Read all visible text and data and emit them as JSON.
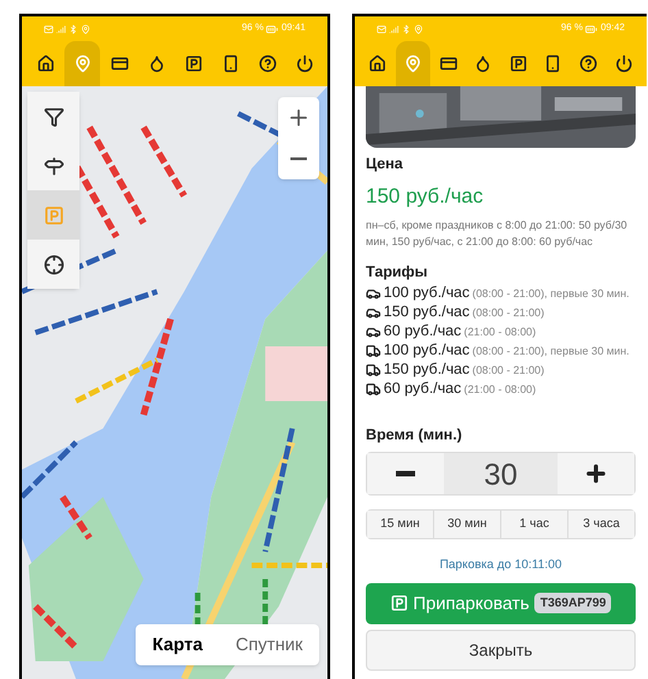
{
  "left_phone": {
    "status_bar": {
      "battery": "96 %",
      "time": "09:41"
    },
    "nav": [
      {
        "kind": "home",
        "selected": false
      },
      {
        "kind": "pin",
        "selected": true
      },
      {
        "kind": "card",
        "selected": false
      },
      {
        "kind": "drop",
        "selected": false
      },
      {
        "kind": "parking",
        "selected": false
      },
      {
        "kind": "phone",
        "selected": false
      },
      {
        "kind": "help",
        "selected": false
      },
      {
        "kind": "power",
        "selected": false
      }
    ],
    "map_tools": [
      {
        "kind": "filter",
        "selected": false
      },
      {
        "kind": "signpost",
        "selected": false
      },
      {
        "kind": "parking",
        "selected": true
      },
      {
        "kind": "locate",
        "selected": false
      }
    ],
    "map_type": [
      {
        "label": "Карта",
        "selected": true
      },
      {
        "label": "Спутник",
        "selected": false
      }
    ]
  },
  "right_phone": {
    "status_bar": {
      "battery": "96 %",
      "time": "09:42"
    },
    "nav": [
      {
        "kind": "home",
        "selected": false
      },
      {
        "kind": "pin",
        "selected": true
      },
      {
        "kind": "card",
        "selected": false
      },
      {
        "kind": "drop",
        "selected": false
      },
      {
        "kind": "parking",
        "selected": false
      },
      {
        "kind": "phone",
        "selected": false
      },
      {
        "kind": "help",
        "selected": false
      },
      {
        "kind": "power",
        "selected": false
      }
    ],
    "price_label": "Цена",
    "price": "150 руб./час",
    "description": "пн–сб, кроме праздников с 8:00 до 21:00: 50 руб/30 мин, 150 руб/час, с 21:00 до 8:00: 60 руб/час",
    "tariffs_title": "Тарифы",
    "tariffs": [
      {
        "kind": "car",
        "price": "100 руб./час",
        "note": "(08:00 - 21:00), первые 30 мин."
      },
      {
        "kind": "car",
        "price": "150 руб./час",
        "note": "(08:00 - 21:00)"
      },
      {
        "kind": "car",
        "price": "60 руб./час",
        "note": "(21:00 - 08:00)"
      },
      {
        "kind": "truck",
        "price": "100 руб./час",
        "note": "(08:00 - 21:00), первые 30 мин."
      },
      {
        "kind": "truck",
        "price": "150 руб./час",
        "note": "(08:00 - 21:00)"
      },
      {
        "kind": "truck",
        "price": "60 руб./час",
        "note": "(21:00 - 08:00)"
      }
    ],
    "time_label": "Время (мин.)",
    "time_value": "30",
    "quick_times": [
      "15 мин",
      "30 мин",
      "1 час",
      "3 часа"
    ],
    "parking_until": "Парковка до 10:11:00",
    "park_button": {
      "label": "Припарковать",
      "plate": "Т369АР799"
    },
    "close_button": "Закрыть"
  }
}
